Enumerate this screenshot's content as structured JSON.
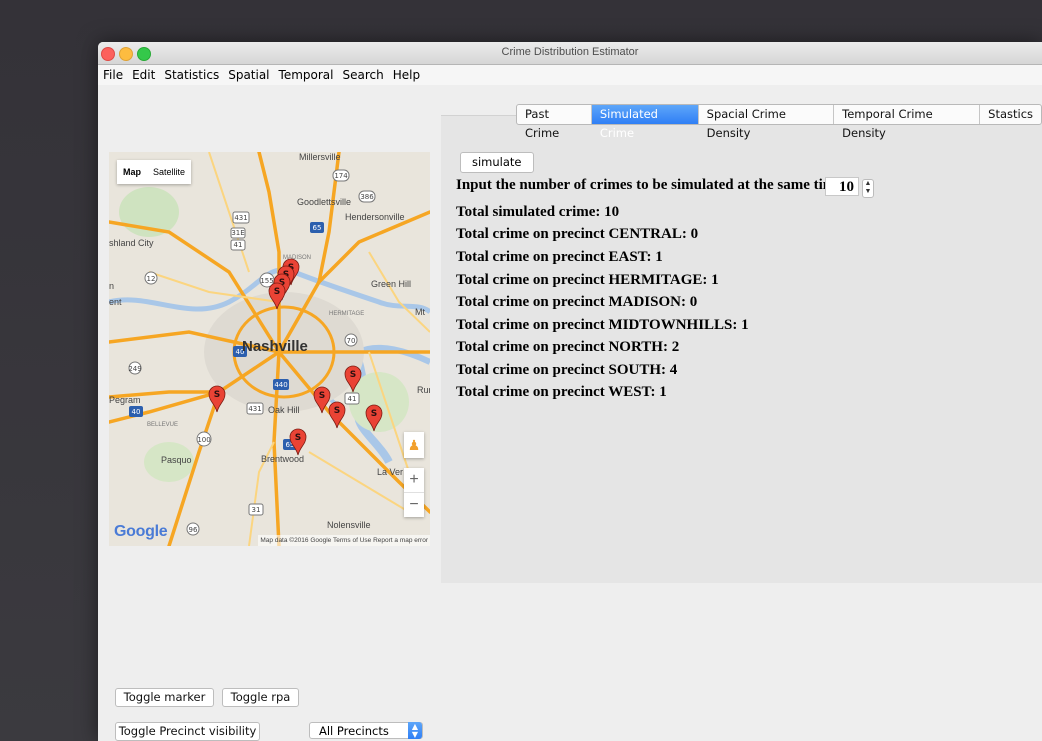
{
  "window": {
    "title": "Crime Distribution Estimator"
  },
  "menu": [
    "File",
    "Edit",
    "Statistics",
    "Spatial",
    "Temporal",
    "Search",
    "Help"
  ],
  "map": {
    "type_map": "Map",
    "type_satellite": "Satellite",
    "labels": {
      "millersville": "Millersville",
      "goodlettsville": "Goodlettsville",
      "hendersonville": "Hendersonville",
      "ashland_city": "shland City",
      "madison": "MADISON",
      "green_hill": "Green Hill",
      "hermitage": "HERMITAGE",
      "mt": "Mt",
      "nashville": "Nashville",
      "pegram": "Pegram",
      "oak_hill": "Oak Hill",
      "bellevue": "BELLEVUE",
      "pasquo": "Pasquo",
      "brentwood": "Brentwood",
      "la_vergne": "La Ver",
      "nolensville": "Nolensville",
      "run": "Rur",
      "ent": "ent",
      "r_n": "n"
    },
    "road_shields": [
      "174",
      "386",
      "431",
      "31E",
      "41",
      "65",
      "12",
      "155",
      "70",
      "40",
      "249",
      "440",
      "431",
      "41",
      "40",
      "100",
      "65",
      "96",
      "31"
    ],
    "marker_label": "S",
    "google": "Google",
    "attribution": "Map data ©2016 Google   Terms of Use   Report a map error",
    "zoom_in": "+",
    "zoom_out": "−"
  },
  "tabs": [
    "Past Crime",
    "Simulated Crime",
    "Spacial Crime Density",
    "Temporal Crime Density",
    "Stastics"
  ],
  "active_tab": "Simulated Crime",
  "simulate_button": "simulate",
  "input_label": "Input the number of crimes to be simulated at the same time",
  "input_value": "10",
  "stats": [
    "Total simulated crime: 10",
    "Total crime on precinct CENTRAL: 0",
    "Total crime on precinct EAST: 1",
    "Total crime on precinct HERMITAGE: 1",
    "Total crime on precinct MADISON: 0",
    "Total crime on precinct MIDTOWNHILLS: 1",
    "Total crime on precinct NORTH: 2",
    "Total crime on precinct SOUTH: 4",
    "Total crime on precinct WEST: 1"
  ],
  "controls": {
    "toggle_marker": "Toggle marker",
    "toggle_rpa": "Toggle rpa",
    "toggle_precinct": "Toggle Precinct visibility",
    "precinct_select": "All Precincts"
  }
}
